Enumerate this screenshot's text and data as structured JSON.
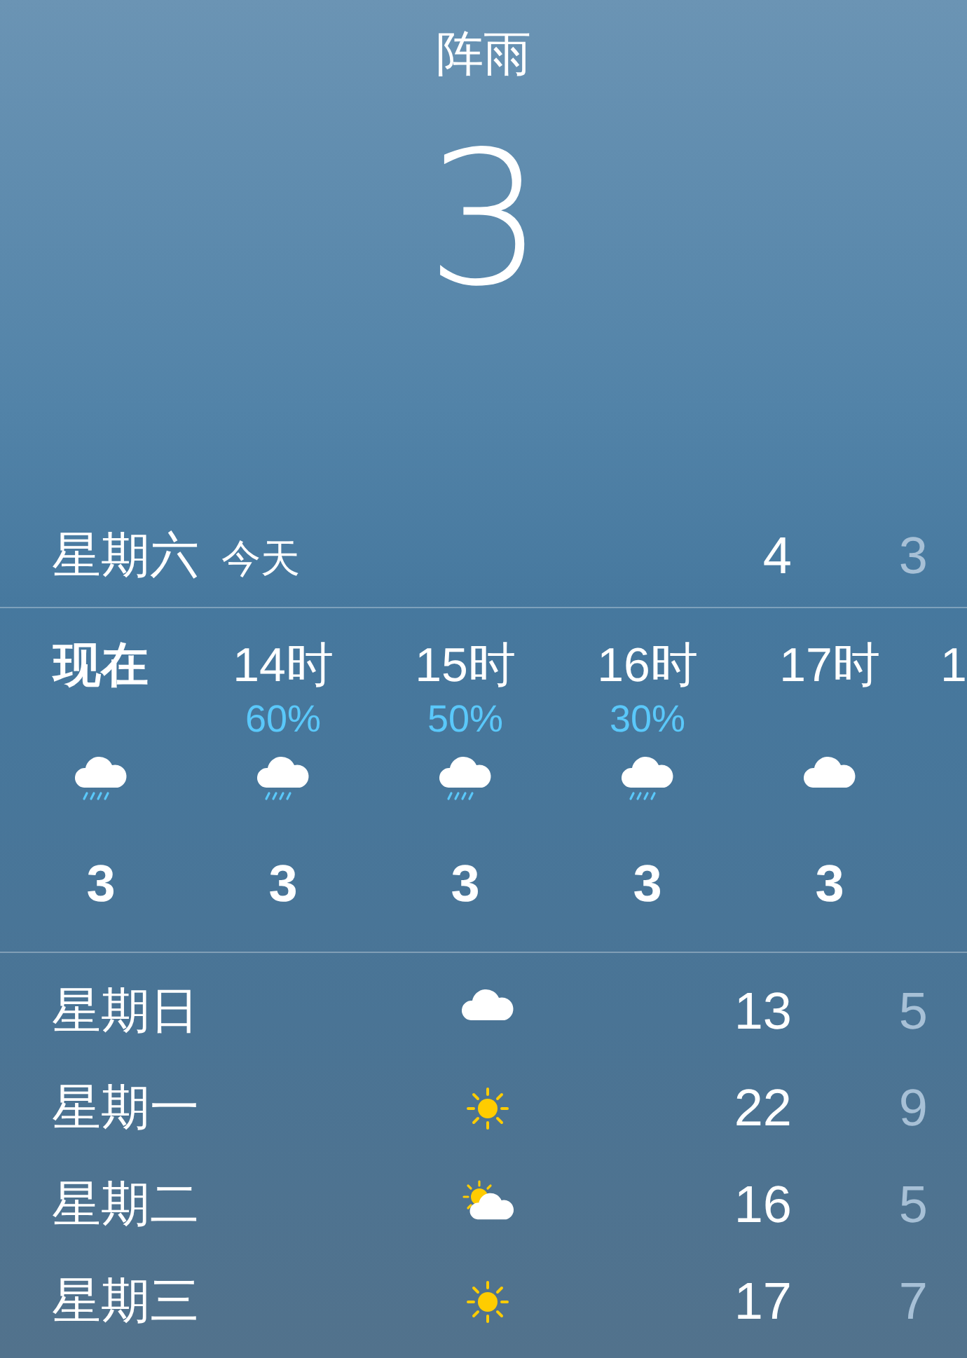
{
  "current": {
    "condition": "阵雨",
    "temperature": "3"
  },
  "today": {
    "day": "星期六",
    "label": "今天",
    "high": "4",
    "low": "3"
  },
  "hourly": [
    {
      "time": "现在",
      "kind": "now",
      "icon": {
        "kind": "rain"
      },
      "temp": "3"
    },
    {
      "time": "14时",
      "kind": "hour",
      "precip": "60%",
      "icon": {
        "kind": "rain"
      },
      "temp": "3"
    },
    {
      "time": "15时",
      "kind": "hour",
      "precip": "50%",
      "icon": {
        "kind": "rain"
      },
      "temp": "3"
    },
    {
      "time": "16时",
      "kind": "hour",
      "precip": "30%",
      "icon": {
        "kind": "rain"
      },
      "temp": "3"
    },
    {
      "time": "17时",
      "kind": "hour",
      "icon": {
        "kind": "cloud"
      },
      "temp": "3"
    },
    {
      "time": "1",
      "kind": "partial"
    }
  ],
  "daily": [
    {
      "day": "星期日",
      "kind": "cloud",
      "high": "13",
      "low": "5"
    },
    {
      "day": "星期一",
      "kind": "sun",
      "high": "22",
      "low": "9"
    },
    {
      "day": "星期二",
      "kind": "partly-sunny",
      "high": "16",
      "low": "5"
    },
    {
      "day": "星期三",
      "kind": "sun",
      "high": "17",
      "low": "7"
    }
  ]
}
